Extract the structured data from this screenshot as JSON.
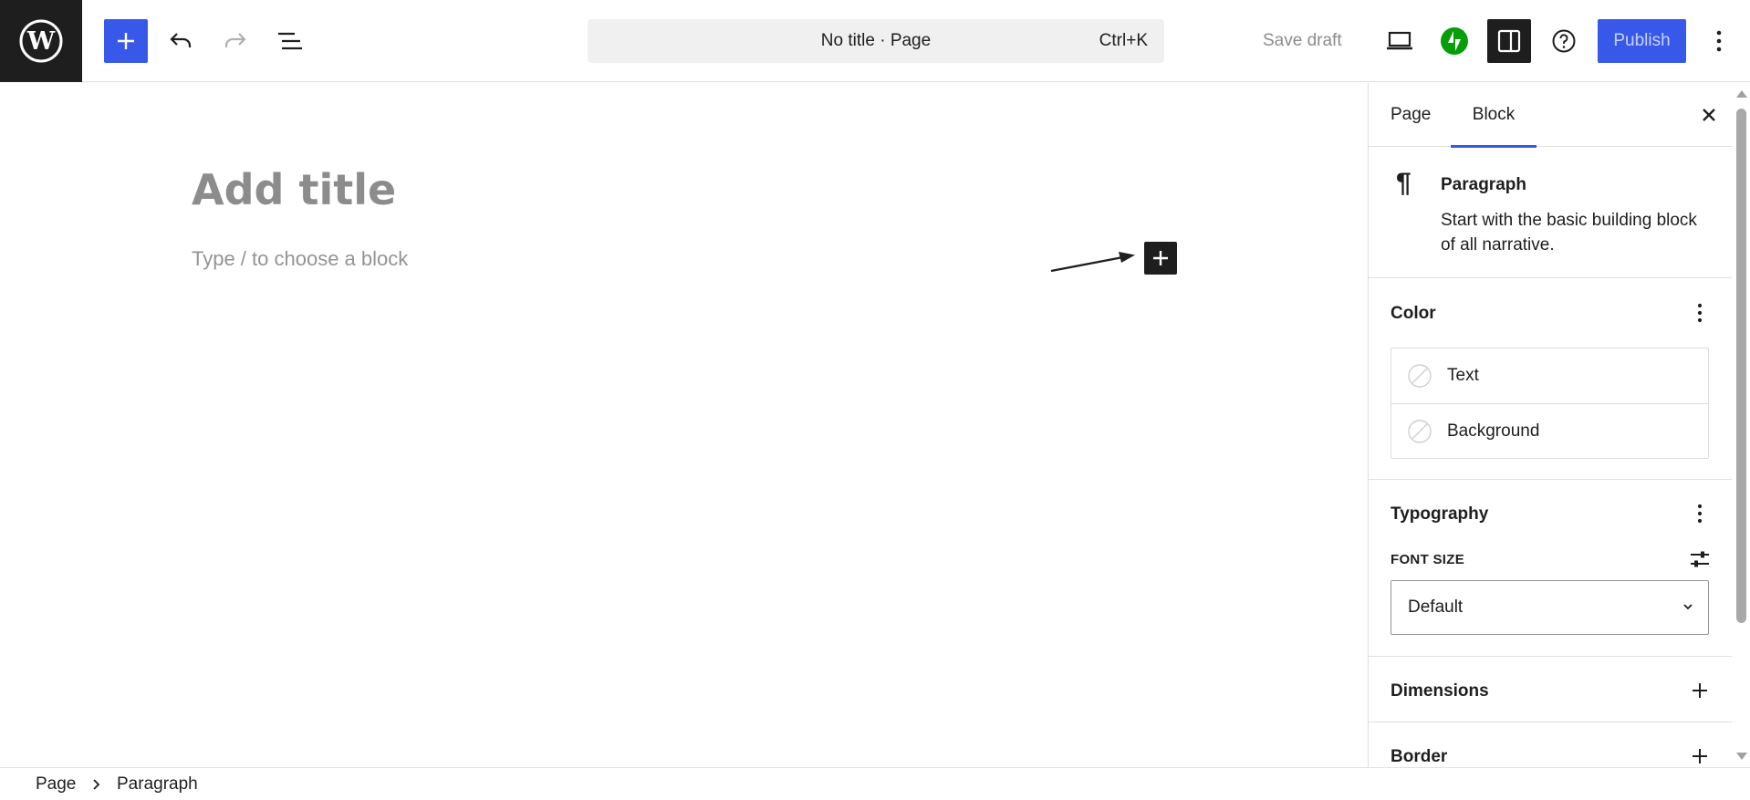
{
  "header": {
    "document_title": "No title · Page",
    "command_shortcut": "Ctrl+K",
    "save_draft_label": "Save draft",
    "publish_label": "Publish"
  },
  "editor": {
    "title_placeholder": "Add title",
    "block_placeholder": "Type / to choose a block"
  },
  "sidebar": {
    "tabs": [
      {
        "label": "Page",
        "active": false
      },
      {
        "label": "Block",
        "active": true
      }
    ],
    "block_card": {
      "title": "Paragraph",
      "description": "Start with the basic building block of all narrative."
    },
    "color_panel": {
      "title": "Color",
      "items": [
        {
          "label": "Text"
        },
        {
          "label": "Background"
        }
      ]
    },
    "typography_panel": {
      "title": "Typography",
      "font_size_label": "FONT SIZE",
      "font_size_value": "Default"
    },
    "dimensions_panel": {
      "title": "Dimensions"
    },
    "border_panel": {
      "title": "Border"
    }
  },
  "footer": {
    "breadcrumb": [
      "Page",
      "Paragraph"
    ]
  },
  "colors": {
    "accent": "#3858e9",
    "dark": "#1e1e1e",
    "jetpack_green": "#069e08",
    "muted_text": "#8c8c8c"
  },
  "icons": [
    "wordpress-logo-icon",
    "plus-icon",
    "undo-icon",
    "redo-icon",
    "list-view-icon",
    "desktop-preview-icon",
    "jetpack-icon",
    "sidebar-settings-icon",
    "help-icon",
    "more-vertical-icon",
    "close-icon",
    "pilcrow-icon",
    "no-color-swatch-icon",
    "sliders-icon",
    "chevron-down-icon",
    "chevron-right-icon",
    "arrow-annotation-icon"
  ]
}
